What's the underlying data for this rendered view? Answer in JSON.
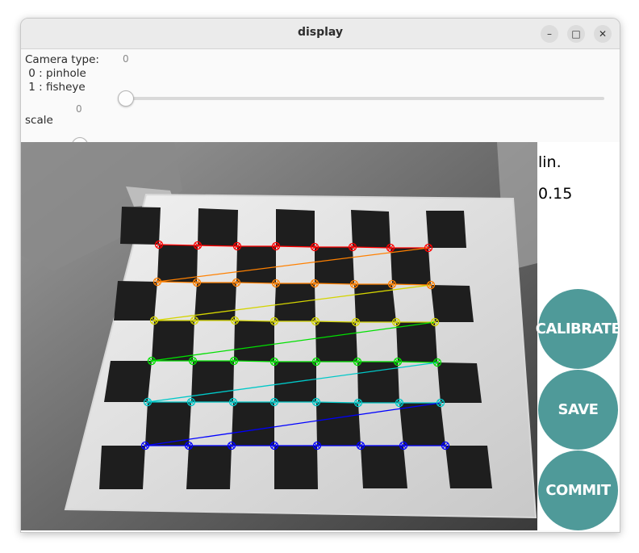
{
  "window": {
    "title": "display",
    "minimize_glyph": "–",
    "maximize_glyph": "□",
    "close_glyph": "✕"
  },
  "controls": {
    "camera_type": {
      "label": "Camera type:\n 0 : pinhole\n 1 : fisheye",
      "value": "0",
      "min": 0,
      "max": 1,
      "current": 0
    },
    "scale": {
      "label": "scale",
      "value": "0",
      "min": 0,
      "max": 100,
      "current": 0
    }
  },
  "side_panel": {
    "mode_text": "lin.",
    "value_text": "0.15",
    "calibrate_label": "CALIBRATE",
    "save_label": "SAVE",
    "commit_label": "COMMIT",
    "button_color": "#4f9a99"
  },
  "detected_corners": {
    "colors": [
      "#ff0000",
      "#ff8000",
      "#d4d400",
      "#00e000",
      "#00c8c8",
      "#0000ff"
    ],
    "rows": [
      [
        [
          197,
          303
        ],
        [
          245,
          304
        ],
        [
          294,
          305
        ],
        [
          342,
          305
        ],
        [
          390,
          306
        ],
        [
          437,
          306
        ],
        [
          484,
          307
        ],
        [
          531,
          307
        ]
      ],
      [
        [
          195,
          349
        ],
        [
          244,
          350
        ],
        [
          293,
          350
        ],
        [
          342,
          351
        ],
        [
          390,
          351
        ],
        [
          439,
          352
        ],
        [
          486,
          352
        ],
        [
          534,
          353
        ]
      ],
      [
        [
          191,
          397
        ],
        [
          241,
          397
        ],
        [
          291,
          397
        ],
        [
          340,
          398
        ],
        [
          391,
          398
        ],
        [
          441,
          399
        ],
        [
          491,
          399
        ],
        [
          539,
          399
        ]
      ],
      [
        [
          188,
          447
        ],
        [
          239,
          447
        ],
        [
          290,
          447
        ],
        [
          340,
          448
        ],
        [
          392,
          448
        ],
        [
          443,
          448
        ],
        [
          493,
          448
        ],
        [
          542,
          449
        ]
      ],
      [
        [
          183,
          498
        ],
        [
          237,
          498
        ],
        [
          289,
          498
        ],
        [
          340,
          498
        ],
        [
          392,
          498
        ],
        [
          444,
          499
        ],
        [
          495,
          499
        ],
        [
          546,
          499
        ]
      ],
      [
        [
          180,
          552
        ],
        [
          234,
          552
        ],
        [
          287,
          552
        ],
        [
          340,
          552
        ],
        [
          393,
          552
        ],
        [
          447,
          552
        ],
        [
          500,
          552
        ],
        [
          552,
          552
        ]
      ]
    ]
  }
}
